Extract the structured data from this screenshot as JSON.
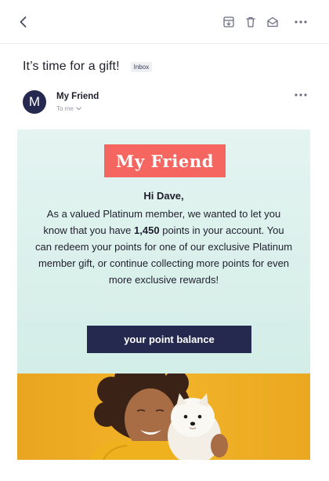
{
  "toolbar": {
    "back_icon": "chevron-left-icon",
    "archive_icon": "archive-icon",
    "trash_icon": "trash-icon",
    "mark_read_icon": "envelope-open-icon",
    "more_icon": "more-horizontal-icon"
  },
  "message": {
    "subject": "It’s time for a gift!",
    "folder_badge": "Inbox",
    "sender": {
      "initial": "M",
      "name": "My Friend",
      "recipient_label": "To me"
    }
  },
  "email": {
    "brand_name": "My Friend",
    "greeting": "Hi Dave,",
    "body_before_points": "As a valued Platinum member, we wanted to let you know that you have",
    "points": "1,450",
    "body_after_points": "points in your account. You can redeem your points for one of our exclusive Platinum member gift, or continue collecting more points for even more exclusive rewards!",
    "cta_label": "your point balance",
    "hero_image": "woman-hugging-white-puppy"
  },
  "colors": {
    "accent_navy": "#25294f",
    "brand_coral": "#f4665f",
    "email_bg_mint": "#dff2ee",
    "hero_yellow": "#f2b42a"
  }
}
